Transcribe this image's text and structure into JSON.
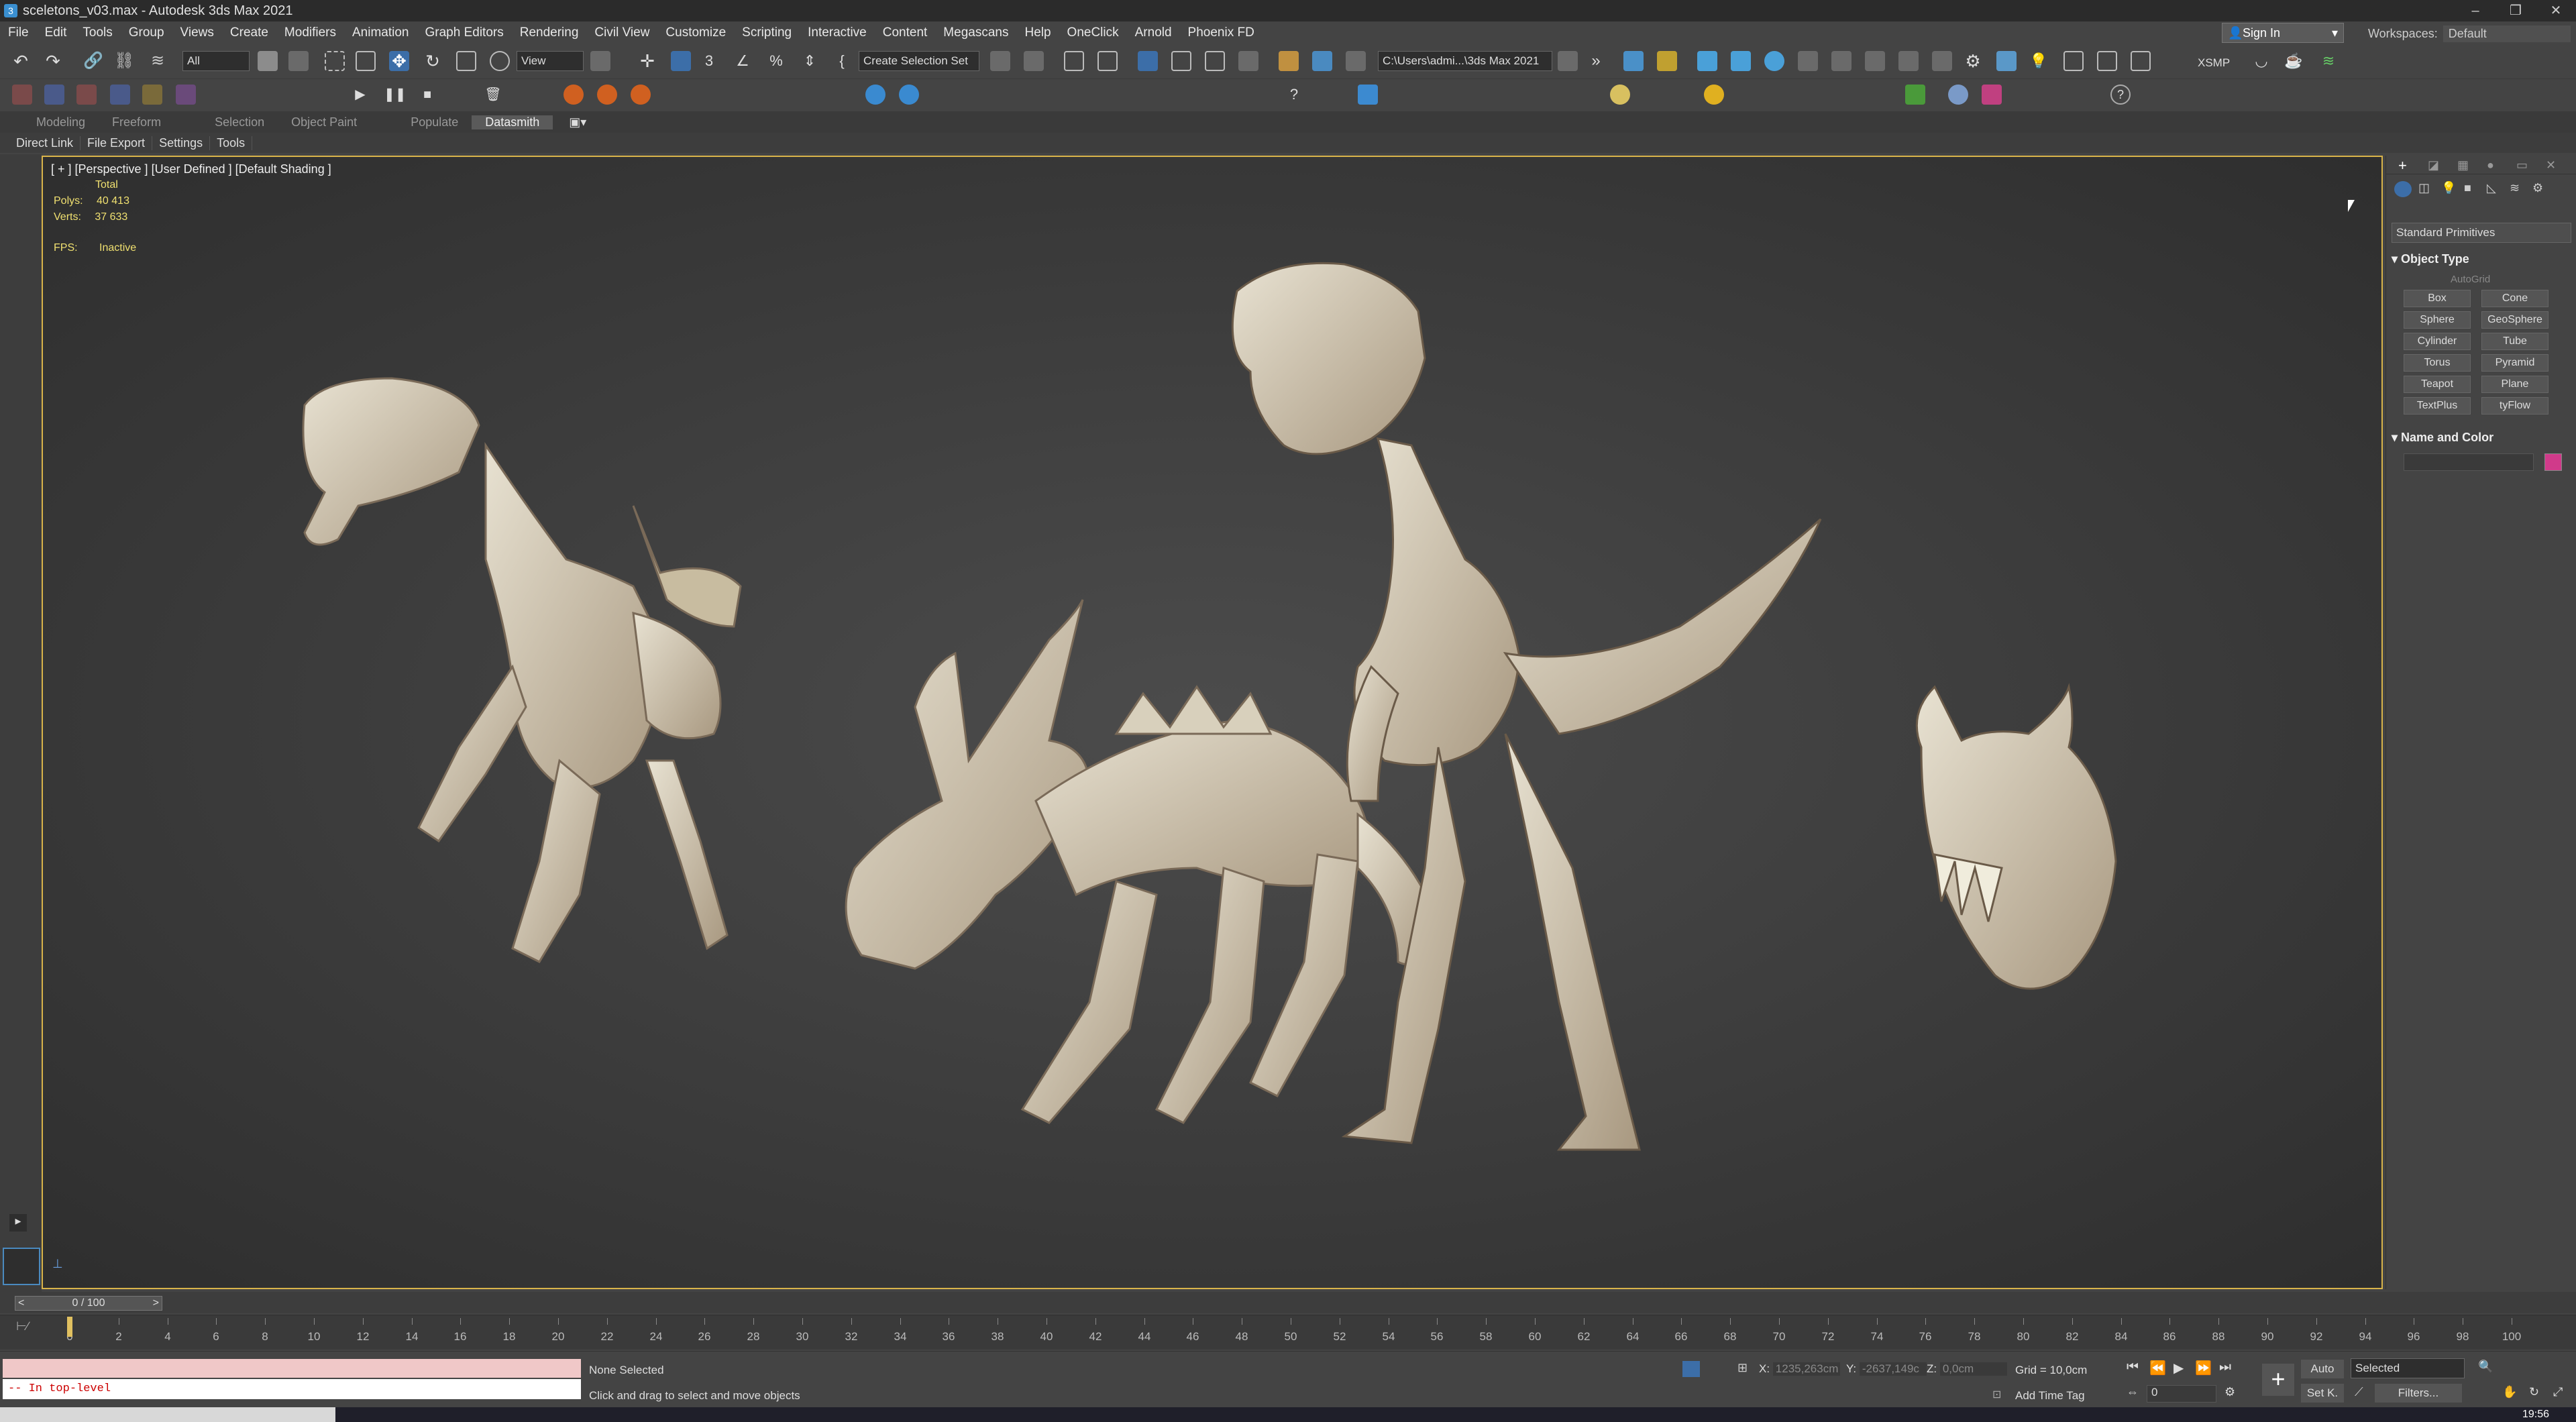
{
  "window": {
    "title": "sceletons_v03.max - Autodesk 3ds Max 2021",
    "controls": [
      "–",
      "❐",
      "✕"
    ]
  },
  "menu": [
    "File",
    "Edit",
    "Tools",
    "Group",
    "Views",
    "Create",
    "Modifiers",
    "Animation",
    "Graph Editors",
    "Rendering",
    "Civil View",
    "Customize",
    "Scripting",
    "Interactive",
    "Content",
    "Megascans",
    "Help",
    "OneClick",
    "Arnold",
    "Phoenix FD"
  ],
  "account": {
    "sign_in": "Sign In",
    "workspaces_label": "Workspaces:",
    "workspace": "Default"
  },
  "toolbar": {
    "selection_filter": "All",
    "ref_coord": "View",
    "selection_set": "Create Selection Set",
    "project_path": "C:\\Users\\admi...\\3ds Max 2021",
    "xsmp": "XSMP"
  },
  "ribbon": {
    "tabs": [
      "Modeling",
      "Freeform",
      "Selection",
      "Object Paint",
      "Populate",
      "Datasmith"
    ],
    "active": "Datasmith"
  },
  "subtabs": [
    "Direct Link",
    "File Export",
    "Settings",
    "Tools"
  ],
  "viewport": {
    "label": "[ + ] [Perspective ] [User Defined ] [Default Shading ]",
    "stats_title": "Total",
    "polys_label": "Polys:",
    "polys_value": "40 413",
    "verts_label": "Verts:",
    "verts_value": "37 633",
    "fps_label": "FPS:",
    "fps_value": "Inactive"
  },
  "command_panel": {
    "category": "Standard Primitives",
    "object_type_title": "Object Type",
    "autogrid": "AutoGrid",
    "buttons": [
      "Box",
      "Cone",
      "Sphere",
      "GeoSphere",
      "Cylinder",
      "Tube",
      "Torus",
      "Pyramid",
      "Teapot",
      "Plane",
      "TextPlus",
      "tyFlow"
    ],
    "name_color_title": "Name and Color",
    "object_color": "#d03a8a"
  },
  "timeline": {
    "slider": "0 / 100",
    "ticks": [
      "0",
      "2",
      "4",
      "6",
      "8",
      "10",
      "12",
      "14",
      "16",
      "18",
      "20",
      "22",
      "24",
      "26",
      "28",
      "30",
      "32",
      "34",
      "36",
      "38",
      "40",
      "42",
      "44",
      "46",
      "48",
      "50",
      "52",
      "54",
      "56",
      "58",
      "60",
      "62",
      "64",
      "66",
      "68",
      "70",
      "72",
      "74",
      "76",
      "78",
      "80",
      "82",
      "84",
      "86",
      "88",
      "90",
      "92",
      "94",
      "96",
      "98",
      "100"
    ]
  },
  "status": {
    "maxscript_output": "-- In top-level",
    "selection": "None Selected",
    "prompt": "Click and drag to select and move objects",
    "x_label": "X:",
    "x_value": "1235,263cm",
    "y_label": "Y:",
    "y_value": "-2637,149c",
    "z_label": "Z:",
    "z_value": "0,0cm",
    "grid": "Grid = 10,0cm",
    "add_time_tag": "Add Time Tag",
    "auto": "Auto",
    "set_key": "Set K.",
    "key_filter": "Selected",
    "filters": "Filters...",
    "frame": "0",
    "clock": "19:56"
  }
}
